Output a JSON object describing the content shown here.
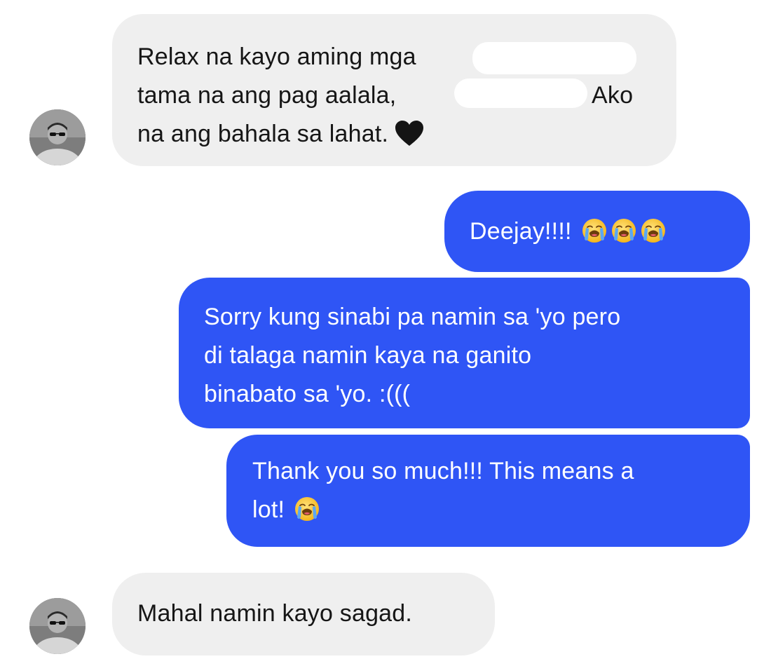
{
  "conversation": {
    "messages": [
      {
        "id": "m1",
        "direction": "incoming",
        "lines": [
          "Relax na kayo aming mga",
          "tama na ang pag aalala,",
          "na ang bahala sa lahat."
        ],
        "trailing_text": "Ako",
        "emoji": "black-heart-icon"
      },
      {
        "id": "m2",
        "direction": "outgoing",
        "lines": [
          "Deejay!!!!"
        ],
        "emoji": "loudly-crying-face-icon",
        "emoji_count": 3
      },
      {
        "id": "m3",
        "direction": "outgoing",
        "lines": [
          "Sorry kung sinabi pa namin sa 'yo pero",
          "di talaga namin kaya na ganito",
          "binabato sa 'yo. :((("
        ]
      },
      {
        "id": "m4",
        "direction": "outgoing",
        "lines": [
          "Thank you so much!!! This means a",
          "lot!"
        ],
        "emoji": "loudly-crying-face-icon",
        "emoji_count": 1
      },
      {
        "id": "m5",
        "direction": "incoming",
        "lines": [
          "Mahal namin kayo sagad."
        ]
      }
    ]
  },
  "colors": {
    "incoming_bubble": "#efefef",
    "outgoing_bubble": "#2f55f5",
    "incoming_text": "#161616",
    "outgoing_text": "#ffffff",
    "background": "#ffffff"
  },
  "icons": {
    "avatar": "contact-avatar-photo",
    "heart": "black-heart-icon",
    "cry": "loudly-crying-face-icon"
  }
}
